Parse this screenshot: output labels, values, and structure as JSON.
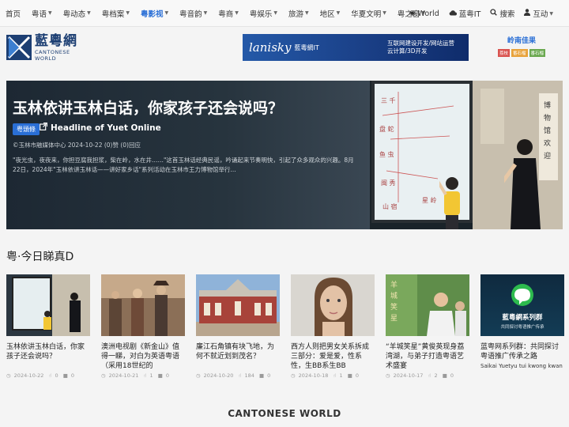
{
  "nav": {
    "items": [
      {
        "label": "首页",
        "caret": false,
        "active": false
      },
      {
        "label": "粤语",
        "caret": true,
        "active": false
      },
      {
        "label": "粤动态",
        "caret": true,
        "active": false
      },
      {
        "label": "粤档案",
        "caret": true,
        "active": false
      },
      {
        "label": "粤影视",
        "caret": true,
        "active": true
      },
      {
        "label": "粤音韵",
        "caret": true,
        "active": false
      },
      {
        "label": "粤商",
        "caret": true,
        "active": false
      },
      {
        "label": "粤娱乐",
        "caret": true,
        "active": false
      },
      {
        "label": "旅游",
        "caret": true,
        "active": false
      },
      {
        "label": "地区",
        "caret": true,
        "active": false
      },
      {
        "label": "华夏文明",
        "caret": true,
        "active": false
      },
      {
        "label": "粤之窗",
        "caret": true,
        "active": false
      }
    ],
    "right": {
      "world_label": "World",
      "it_label": "蓝粤IT",
      "search_label": "搜索",
      "interact_label": "互动"
    }
  },
  "header": {
    "logo_cn": "藍粵網",
    "logo_en": "CANTONESE WORLD",
    "banner": {
      "brand": "lanisky",
      "sub": "藍粵網IT",
      "line1": "互联网建设开发/网站运营",
      "line2": "云计算/3D开发"
    },
    "side_ad": {
      "title": "岭南佳果",
      "tags": [
        {
          "label": "荔枝",
          "color": "#d9534f"
        },
        {
          "label": "番石榴",
          "color": "#e8a23a"
        },
        {
          "label": "番石榴",
          "color": "#6aa84f"
        }
      ]
    }
  },
  "hero": {
    "title": "玉林依讲玉林白话，你家孩子还会说吗？",
    "category": "粤頭條",
    "link_text": "Headline of Yuet Online",
    "meta": "©玉林市融媒体中心 2024-10-22 (0)赞 (0)回应",
    "excerpt": "\"夜光虫，夜夜来，你担豆腐我担浆，柴在岭，水在井……\"这首玉林话经典民谣，吟诵起来节奏明快，引起了众多观众的兴趣。8月22日，2024年\"玉林依讲玉林话——讲好家乡话\"系列活动在玉林市王力博物馆举行..."
  },
  "section": {
    "title": "粤·今日睇真D",
    "cards": [
      {
        "title": "玉林依讲玉林白话，你家孩子还会说吗？",
        "date": "2024-10-22",
        "likes": "0",
        "comments": "0",
        "sub": ""
      },
      {
        "title": "澳洲电视剧《新金山》值得一睇，对白为英语粤语（采用18世纪的",
        "date": "2024-10-21",
        "likes": "1",
        "comments": "0",
        "sub": ""
      },
      {
        "title": "廉江石角镇有块飞地，为何不就近划到茂名？",
        "date": "2024-10-20",
        "likes": "184",
        "comments": "0",
        "sub": ""
      },
      {
        "title": "西方人则把男女关系拆成三部分：爱是爱，性系性，生BB系生BB",
        "date": "2024-10-18",
        "likes": "1",
        "comments": "0",
        "sub": ""
      },
      {
        "title": "“羊城笑星”黄俊英现身荔湾湖，与弟子打造粤语艺术盛宴",
        "date": "2024-10-17",
        "likes": "2",
        "comments": "0",
        "sub": ""
      },
      {
        "title": "蓝粤网系列群：共同探讨粤语推广传承之路",
        "date": "",
        "likes": "",
        "comments": "",
        "sub": "Saikai Yuetyu tui kwong kwan"
      }
    ]
  },
  "thumb5": {
    "line1": "藍粵網系列群",
    "line2": "共同探讨粤语推广传承"
  },
  "footer": {
    "title": "CANTONESE WORLD"
  }
}
